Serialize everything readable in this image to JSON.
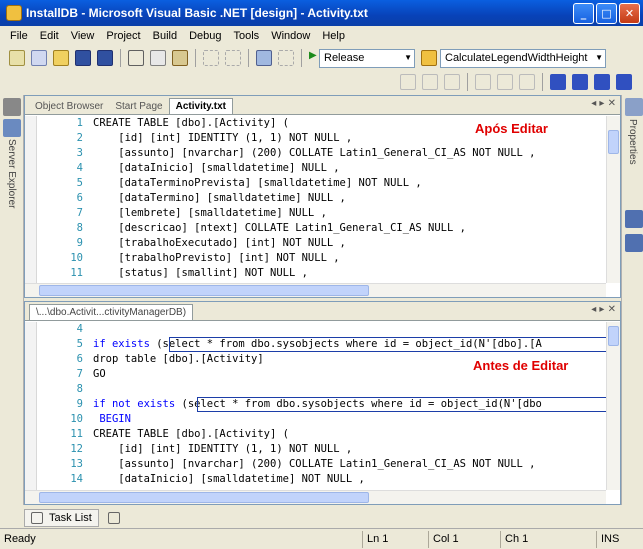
{
  "window": {
    "title": "InstallDB - Microsoft Visual Basic .NET [design] - Activity.txt",
    "minimize": "_",
    "maximize": "□",
    "close": "✕"
  },
  "menu": [
    "File",
    "Edit",
    "View",
    "Project",
    "Build",
    "Debug",
    "Tools",
    "Window",
    "Help"
  ],
  "toolbar": {
    "config": "Release",
    "find_target": "CalculateLegendWidthHeight"
  },
  "left_rail": {
    "server_explorer": "Server Explorer"
  },
  "right_rail": {
    "properties": "Properties"
  },
  "top_pane": {
    "tabs": [
      "Object Browser",
      "Start Page",
      "Activity.txt"
    ],
    "annotation": "Após Editar",
    "lines": [
      {
        "n": "1",
        "t": "CREATE TABLE [dbo].[Activity] ("
      },
      {
        "n": "2",
        "t": "    [id] [int] IDENTITY (1, 1) NOT NULL ,"
      },
      {
        "n": "3",
        "t": "    [assunto] [nvarchar] (200) COLLATE Latin1_General_CI_AS NOT NULL ,"
      },
      {
        "n": "4",
        "t": "    [dataInicio] [smalldatetime] NULL ,"
      },
      {
        "n": "5",
        "t": "    [dataTerminoPrevista] [smalldatetime] NOT NULL ,"
      },
      {
        "n": "6",
        "t": "    [dataTermino] [smalldatetime] NULL ,"
      },
      {
        "n": "7",
        "t": "    [lembrete] [smalldatetime] NULL ,"
      },
      {
        "n": "8",
        "t": "    [descricao] [ntext] COLLATE Latin1_General_CI_AS NULL ,"
      },
      {
        "n": "9",
        "t": "    [trabalhoExecutado] [int] NOT NULL ,"
      },
      {
        "n": "10",
        "t": "    [trabalhoPrevisto] [int] NOT NULL ,"
      },
      {
        "n": "11",
        "t": "    [status] [smallint] NOT NULL ,"
      }
    ]
  },
  "bottom_pane": {
    "tab": "\\...\\dbo.Activit...ctivityManagerDB)",
    "annotation": "Antes de Editar",
    "l4": "4",
    "l5n": "5",
    "l5a": "if exists ",
    "l5b": "(select * from dbo.sysobjects where id = object_id(N'[dbo].[A",
    "l6n": "6",
    "l6": "drop table [dbo].[Activity]",
    "l7n": "7",
    "l7": "GO",
    "l8n": "8",
    "l9n": "9",
    "l9a": "if not exists ",
    "l9b": "(select * from dbo.sysobjects where id = object_id(N'[dbo",
    "l10n": "10",
    "l10": " BEGIN",
    "l11n": "11",
    "l11": "CREATE TABLE [dbo].[Activity] (",
    "l12n": "12",
    "l12": "    [id] [int] IDENTITY (1, 1) NOT NULL ,",
    "l13n": "13",
    "l13": "    [assunto] [nvarchar] (200) COLLATE Latin1_General_CI_AS NOT NULL ,",
    "l14n": "14",
    "l14": "    [dataInicio] [smalldatetime] NOT NULL ,"
  },
  "task_list": {
    "label": "Task List"
  },
  "status": {
    "ready": "Ready",
    "ln": "Ln 1",
    "col": "Col 1",
    "ch": "Ch 1",
    "ins": "INS"
  }
}
